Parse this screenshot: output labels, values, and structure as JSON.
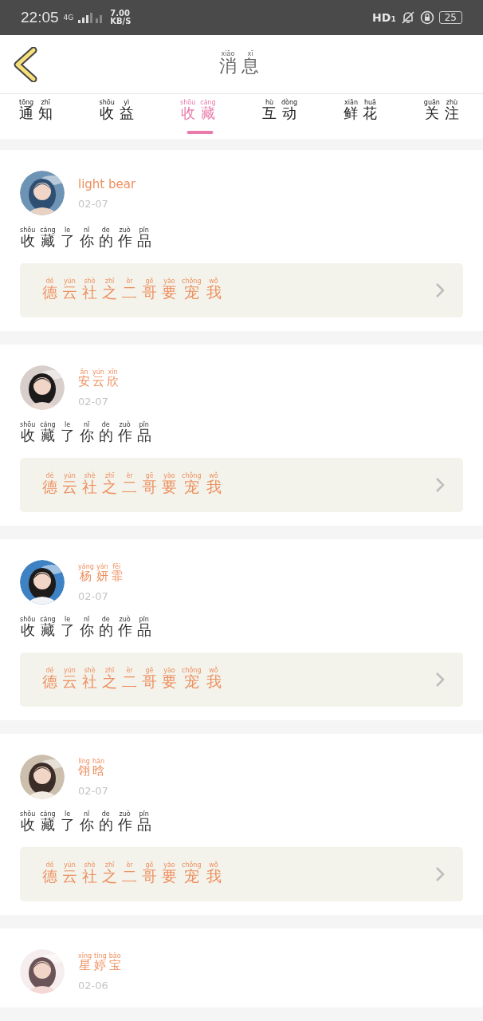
{
  "status_bar": {
    "time": "22:05",
    "network": "4G",
    "speed": "7.00",
    "speed_unit": "KB/S",
    "hd": "HD",
    "hd_sub": "1",
    "battery": "25"
  },
  "header": {
    "title": [
      {
        "char": "消",
        "pinyin": "xiāo"
      },
      {
        "char": "息",
        "pinyin": "xī"
      }
    ]
  },
  "tabs": [
    {
      "label": [
        {
          "char": "通",
          "pinyin": "tōng"
        },
        {
          "char": "知",
          "pinyin": "zhī"
        }
      ],
      "selected": false
    },
    {
      "label": [
        {
          "char": "收",
          "pinyin": "shōu"
        },
        {
          "char": "益",
          "pinyin": "yì"
        }
      ],
      "selected": false
    },
    {
      "label": [
        {
          "char": "收",
          "pinyin": "shōu"
        },
        {
          "char": "藏",
          "pinyin": "cáng"
        }
      ],
      "selected": true
    },
    {
      "label": [
        {
          "char": "互",
          "pinyin": "hù"
        },
        {
          "char": "动",
          "pinyin": "dòng"
        }
      ],
      "selected": false
    },
    {
      "label": [
        {
          "char": "鲜",
          "pinyin": "xiān"
        },
        {
          "char": "花",
          "pinyin": "huā"
        }
      ],
      "selected": false
    },
    {
      "label": [
        {
          "char": "关",
          "pinyin": "guān"
        },
        {
          "char": "注",
          "pinyin": "zhù"
        }
      ],
      "selected": false
    }
  ],
  "messages": [
    {
      "user": {
        "kind": "latin",
        "name": "light bear"
      },
      "date": "02-07",
      "action": [
        {
          "char": "收",
          "pinyin": "shōu"
        },
        {
          "char": "藏",
          "pinyin": "cáng"
        },
        {
          "char": "了",
          "pinyin": "le"
        },
        {
          "char": "你",
          "pinyin": "nǐ"
        },
        {
          "char": "的",
          "pinyin": "de"
        },
        {
          "char": "作",
          "pinyin": "zuò"
        },
        {
          "char": "品",
          "pinyin": "pǐn"
        }
      ],
      "work": [
        {
          "char": "德",
          "pinyin": "dé"
        },
        {
          "char": "云",
          "pinyin": "yún"
        },
        {
          "char": "社",
          "pinyin": "shè"
        },
        {
          "char": "之",
          "pinyin": "zhī"
        },
        {
          "char": "二",
          "pinyin": "èr"
        },
        {
          "char": "哥",
          "pinyin": "gē"
        },
        {
          "char": "要",
          "pinyin": "yào"
        },
        {
          "char": "宠",
          "pinyin": "chǒng"
        },
        {
          "char": "我",
          "pinyin": "wǒ"
        }
      ]
    },
    {
      "user": {
        "kind": "hanzi",
        "name": [
          {
            "char": "安",
            "pinyin": "ān"
          },
          {
            "char": "云",
            "pinyin": "yún"
          },
          {
            "char": "欣",
            "pinyin": "xīn"
          }
        ]
      },
      "date": "02-07",
      "action": [
        {
          "char": "收",
          "pinyin": "shōu"
        },
        {
          "char": "藏",
          "pinyin": "cáng"
        },
        {
          "char": "了",
          "pinyin": "le"
        },
        {
          "char": "你",
          "pinyin": "nǐ"
        },
        {
          "char": "的",
          "pinyin": "de"
        },
        {
          "char": "作",
          "pinyin": "zuò"
        },
        {
          "char": "品",
          "pinyin": "pǐn"
        }
      ],
      "work": [
        {
          "char": "德",
          "pinyin": "dé"
        },
        {
          "char": "云",
          "pinyin": "yún"
        },
        {
          "char": "社",
          "pinyin": "shè"
        },
        {
          "char": "之",
          "pinyin": "zhī"
        },
        {
          "char": "二",
          "pinyin": "èr"
        },
        {
          "char": "哥",
          "pinyin": "gē"
        },
        {
          "char": "要",
          "pinyin": "yào"
        },
        {
          "char": "宠",
          "pinyin": "chǒng"
        },
        {
          "char": "我",
          "pinyin": "wǒ"
        }
      ]
    },
    {
      "user": {
        "kind": "hanzi",
        "name": [
          {
            "char": "杨",
            "pinyin": "yáng"
          },
          {
            "char": "妍",
            "pinyin": "yán"
          },
          {
            "char": "霏",
            "pinyin": "fēi"
          }
        ]
      },
      "date": "02-07",
      "action": [
        {
          "char": "收",
          "pinyin": "shōu"
        },
        {
          "char": "藏",
          "pinyin": "cáng"
        },
        {
          "char": "了",
          "pinyin": "le"
        },
        {
          "char": "你",
          "pinyin": "nǐ"
        },
        {
          "char": "的",
          "pinyin": "de"
        },
        {
          "char": "作",
          "pinyin": "zuò"
        },
        {
          "char": "品",
          "pinyin": "pǐn"
        }
      ],
      "work": [
        {
          "char": "德",
          "pinyin": "dé"
        },
        {
          "char": "云",
          "pinyin": "yún"
        },
        {
          "char": "社",
          "pinyin": "shè"
        },
        {
          "char": "之",
          "pinyin": "zhī"
        },
        {
          "char": "二",
          "pinyin": "èr"
        },
        {
          "char": "哥",
          "pinyin": "gē"
        },
        {
          "char": "要",
          "pinyin": "yào"
        },
        {
          "char": "宠",
          "pinyin": "chǒng"
        },
        {
          "char": "我",
          "pinyin": "wǒ"
        }
      ]
    },
    {
      "user": {
        "kind": "hanzi",
        "name": [
          {
            "char": "翎",
            "pinyin": "líng"
          },
          {
            "char": "晗",
            "pinyin": "hán"
          }
        ]
      },
      "date": "02-07",
      "action": [
        {
          "char": "收",
          "pinyin": "shōu"
        },
        {
          "char": "藏",
          "pinyin": "cáng"
        },
        {
          "char": "了",
          "pinyin": "le"
        },
        {
          "char": "你",
          "pinyin": "nǐ"
        },
        {
          "char": "的",
          "pinyin": "de"
        },
        {
          "char": "作",
          "pinyin": "zuò"
        },
        {
          "char": "品",
          "pinyin": "pǐn"
        }
      ],
      "work": [
        {
          "char": "德",
          "pinyin": "dé"
        },
        {
          "char": "云",
          "pinyin": "yún"
        },
        {
          "char": "社",
          "pinyin": "shè"
        },
        {
          "char": "之",
          "pinyin": "zhī"
        },
        {
          "char": "二",
          "pinyin": "èr"
        },
        {
          "char": "哥",
          "pinyin": "gē"
        },
        {
          "char": "要",
          "pinyin": "yào"
        },
        {
          "char": "宠",
          "pinyin": "chǒng"
        },
        {
          "char": "我",
          "pinyin": "wǒ"
        }
      ]
    },
    {
      "user": {
        "kind": "hanzi",
        "name": [
          {
            "char": "星",
            "pinyin": "xīng"
          },
          {
            "char": "婷",
            "pinyin": "tíng"
          },
          {
            "char": "宝",
            "pinyin": "bǎo"
          }
        ]
      },
      "date": "02-06"
    }
  ]
}
